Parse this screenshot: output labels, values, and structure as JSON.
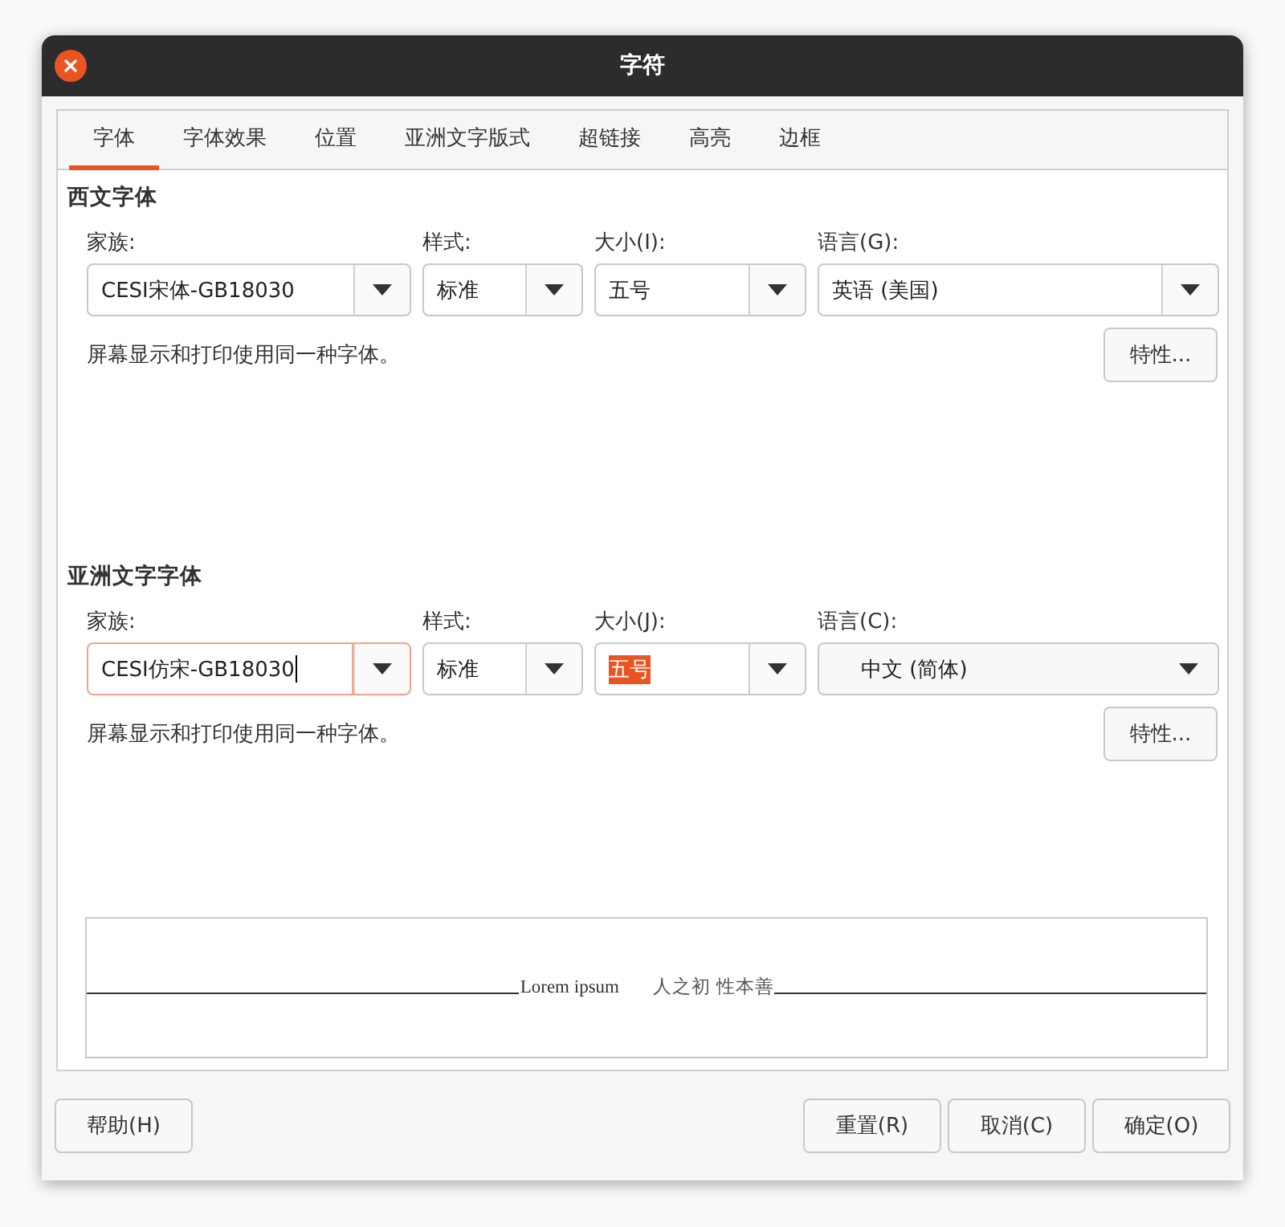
{
  "window": {
    "title": "字符"
  },
  "tabs": [
    {
      "label": "字体",
      "selected": true
    },
    {
      "label": "字体效果",
      "selected": false
    },
    {
      "label": "位置",
      "selected": false
    },
    {
      "label": "亚洲文字版式",
      "selected": false
    },
    {
      "label": "超链接",
      "selected": false
    },
    {
      "label": "高亮",
      "selected": false
    },
    {
      "label": "边框",
      "selected": false
    }
  ],
  "sections": [
    {
      "title": "西文字体",
      "fields": [
        {
          "kind": "editable",
          "label": "家族:",
          "value": "CESI宋体-GB18030",
          "focused": false
        },
        {
          "kind": "combo",
          "label": "样式:",
          "value": "标准",
          "text_selected": false
        },
        {
          "kind": "combo",
          "label": "大小(I):",
          "value": "五号",
          "text_selected": false
        },
        {
          "kind": "combo",
          "label": "语言(G):",
          "value": "英语 (美国)",
          "text_selected": false
        }
      ],
      "note": "屏幕显示和打印使用同一种字体。",
      "properties_button": "特性..."
    },
    {
      "title": "亚洲文字字体",
      "fields": [
        {
          "kind": "editable",
          "label": "家族:",
          "value": "CESI仿宋-GB18030",
          "focused": true
        },
        {
          "kind": "combo",
          "label": "样式:",
          "value": "标准",
          "text_selected": false
        },
        {
          "kind": "combo",
          "label": "大小(J):",
          "value": "五号",
          "text_selected": true
        },
        {
          "kind": "dropdown",
          "label": "语言(C):",
          "value": "中文 (简体)"
        }
      ],
      "note": "屏幕显示和打印使用同一种字体。",
      "properties_button": "特性..."
    }
  ],
  "preview": {
    "latin_sample": "Lorem ipsum",
    "asian_sample": "人之初 性本善"
  },
  "buttons_left": [
    "帮助(H)"
  ],
  "buttons_right": [
    "重置(R)",
    "取消(C)",
    "确定(O)"
  ]
}
